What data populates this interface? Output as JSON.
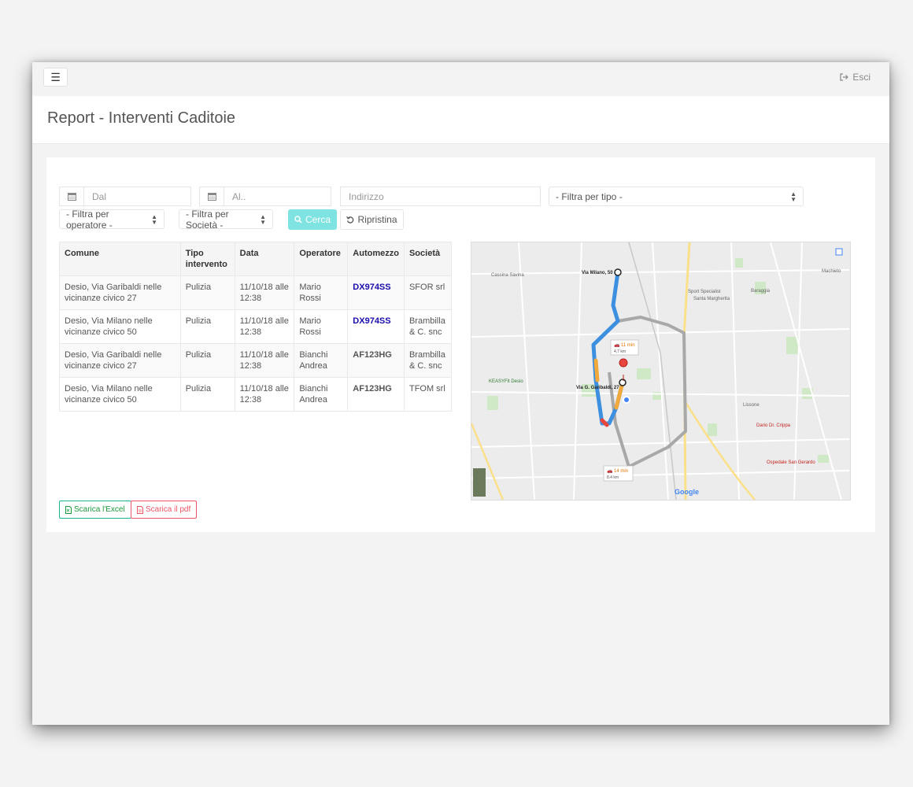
{
  "header": {
    "menu_icon": "hamburger-icon",
    "logout_label": "Esci",
    "logout_icon": "sign-out-icon"
  },
  "page": {
    "title": "Report - Interventi Caditoie"
  },
  "filters": {
    "date_from_placeholder": "Dal",
    "date_to_placeholder": "Al..",
    "address_placeholder": "Indirizzo",
    "type_filter": "- Filtra per tipo -",
    "operator_filter": "- Filtra per operatore -",
    "company_filter": "- Filtra per Società -",
    "search_label": "Cerca",
    "reset_label": "Ripristina"
  },
  "table": {
    "headers": [
      "Comune",
      "Tipo intervento",
      "Data",
      "Operatore",
      "Automezzo",
      "Società"
    ],
    "rows": [
      {
        "comune": "Desio, Via Garibaldi nelle vicinanze civico 27",
        "tipo": "Pulizia",
        "data": "11/10/18 alle 12:38",
        "operatore": "Mario Rossi",
        "automezzo": "DX974SS",
        "societa": "SFOR srl"
      },
      {
        "comune": "Desio, Via Milano nelle vicinanze civico 50",
        "tipo": "Pulizia",
        "data": "11/10/18 alle 12:38",
        "operatore": "Mario Rossi",
        "automezzo": "DX974SS",
        "societa": "Brambilla & C. snc"
      },
      {
        "comune": "Desio, Via Garibaldi nelle vicinanze civico 27",
        "tipo": "Pulizia",
        "data": "11/10/18 alle 12:38",
        "operatore": "Bianchi Andrea",
        "automezzo": "AF123HG",
        "societa": "Brambilla & C. snc"
      },
      {
        "comune": "Desio, Via Milano nelle vicinanze civico 50",
        "tipo": "Pulizia",
        "data": "11/10/18 alle 12:38",
        "operatore": "Bianchi Andrea",
        "automezzo": "AF123HG",
        "societa": "TFOM srl"
      }
    ]
  },
  "map": {
    "origin_label": "Via Milano, 50",
    "destination_label": "Via G. Garibaldi, 27",
    "route1_time": "11 min",
    "route1_distance": "4,7 km",
    "route2_time": "14 min",
    "route2_distance": "8,4 km",
    "places": [
      "Cassina Savina",
      "Santa Margherita",
      "Baraggia",
      "Machieto",
      "KEASYFit Desio",
      "Lissone",
      "Dario Dr. Crippa",
      "Ospedale San Gerardo",
      "Sport Specialist"
    ],
    "brand": "Google",
    "colors": {
      "route_main": "#3d8fe0",
      "route_alt": "#a8a8a8",
      "traffic_slow": "#f2a93b",
      "traffic_heavy": "#e8453c"
    }
  },
  "downloads": {
    "excel_label": "Scarica l'Excel",
    "pdf_label": "Scarica il pdf"
  }
}
